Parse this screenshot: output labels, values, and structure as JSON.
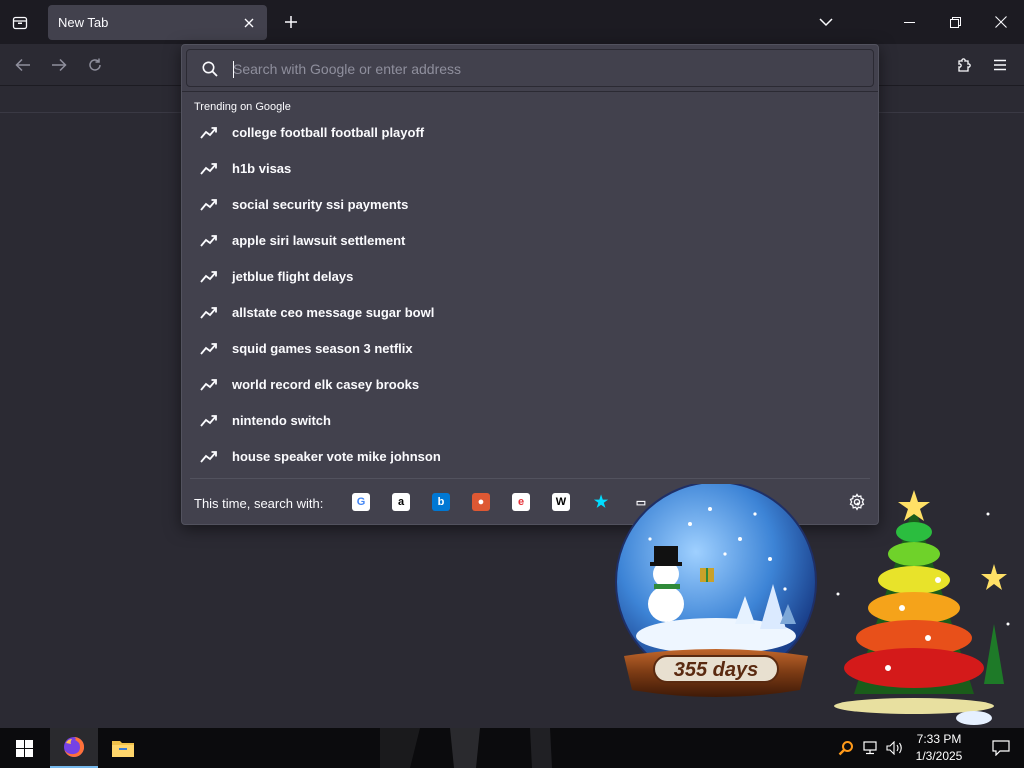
{
  "browser": {
    "tab": {
      "title": "New Tab"
    },
    "window_controls": [
      "minimize",
      "restore",
      "close"
    ]
  },
  "urlbar": {
    "placeholder": "Search with Google or enter address",
    "trending_heading": "Trending on Google",
    "suggestions": [
      "college football football playoff",
      "h1b visas",
      "social security ssi payments",
      "apple siri lawsuit settlement",
      "jetblue flight delays",
      "allstate ceo message sugar bowl",
      "squid games season 3 netflix",
      "world record elk casey brooks",
      "nintendo switch",
      "house speaker vote mike johnson"
    ],
    "oneoff_label": "This time, search with:",
    "engines": [
      {
        "name": "google-icon",
        "glyph": "G",
        "color": "#4285f4",
        "bg": "#ffffff"
      },
      {
        "name": "amazon-icon",
        "glyph": "a",
        "color": "#000000",
        "bg": "#ffffff"
      },
      {
        "name": "bing-icon",
        "glyph": "b",
        "color": "#ffffff",
        "bg": "#0078d4"
      },
      {
        "name": "duckduckgo-icon",
        "glyph": "●",
        "color": "#ffffff",
        "bg": "#de5833"
      },
      {
        "name": "ebay-icon",
        "glyph": "e",
        "color": "#e53238",
        "bg": "#ffffff"
      },
      {
        "name": "wikipedia-icon",
        "glyph": "W",
        "color": "#000000",
        "bg": "#ffffff"
      },
      {
        "name": "bookmarks-icon",
        "glyph": "★",
        "color": "#00ddff",
        "bg": "transparent"
      },
      {
        "name": "tabs-icon",
        "glyph": "▭",
        "color": "#fbfbfe",
        "bg": "transparent"
      }
    ]
  },
  "desktop": {
    "snowglobe_text": "355 days"
  },
  "taskbar": {
    "time": "7:33 PM",
    "date": "1/3/2025"
  },
  "colors": {
    "toolbar": "#2b2a33",
    "tabstrip": "#1c1b22",
    "panel": "#42414d",
    "accent": "#00ddff"
  }
}
